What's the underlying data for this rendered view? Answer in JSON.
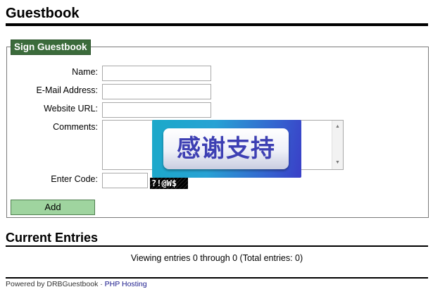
{
  "page_title": "Guestbook",
  "form": {
    "legend": "Sign Guestbook",
    "name_label": "Name:",
    "name_value": "",
    "email_label": "E-Mail Address:",
    "email_value": "",
    "website_label": "Website URL:",
    "website_value": "",
    "comments_label": "Comments:",
    "comments_value": "",
    "code_label": "Enter Code:",
    "code_value": "",
    "captcha_text": "?!@W$",
    "add_button_label": "Add"
  },
  "overlay": {
    "banner_text": "感谢支持"
  },
  "entries": {
    "heading": "Current Entries",
    "summary": "Viewing entries 0 through 0 (Total entries: 0)"
  },
  "footer": {
    "powered_by": "Powered by DRBGuestbook",
    "separator": " · ",
    "hosting_link": "PHP Hosting"
  },
  "icons": {
    "scroll_up": "scroll-up-arrow",
    "scroll_down": "scroll-down-arrow"
  },
  "colors": {
    "legend_bg": "#3b6b3b",
    "add_button_bg": "#9fd49f",
    "banner_text": "#3d3fb3",
    "link": "#1a1a8c"
  }
}
